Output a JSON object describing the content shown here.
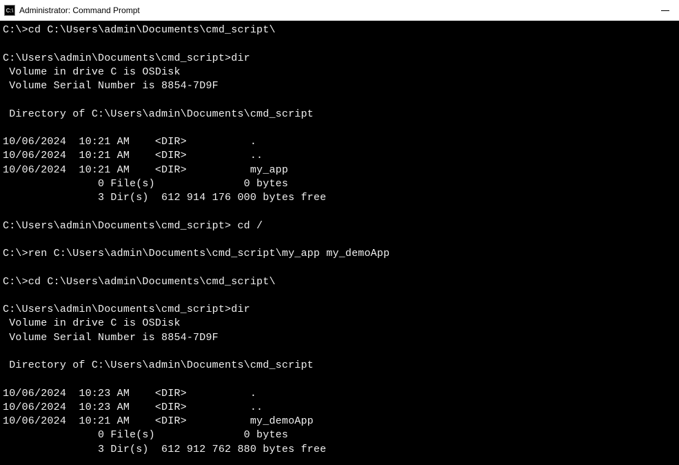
{
  "window": {
    "title": "Administrator: Command Prompt",
    "icon_label": "C:\\"
  },
  "lines": [
    "C:\\>cd C:\\Users\\admin\\Documents\\cmd_script\\",
    "",
    "C:\\Users\\admin\\Documents\\cmd_script>dir",
    " Volume in drive C is OSDisk",
    " Volume Serial Number is 8854-7D9F",
    "",
    " Directory of C:\\Users\\admin\\Documents\\cmd_script",
    "",
    "10/06/2024  10:21 AM    <DIR>          .",
    "10/06/2024  10:21 AM    <DIR>          ..",
    "10/06/2024  10:21 AM    <DIR>          my_app",
    "               0 File(s)              0 bytes",
    "               3 Dir(s)  612 914 176 000 bytes free",
    "",
    "C:\\Users\\admin\\Documents\\cmd_script> cd /",
    "",
    "C:\\>ren C:\\Users\\admin\\Documents\\cmd_script\\my_app my_demoApp",
    "",
    "C:\\>cd C:\\Users\\admin\\Documents\\cmd_script\\",
    "",
    "C:\\Users\\admin\\Documents\\cmd_script>dir",
    " Volume in drive C is OSDisk",
    " Volume Serial Number is 8854-7D9F",
    "",
    " Directory of C:\\Users\\admin\\Documents\\cmd_script",
    "",
    "10/06/2024  10:23 AM    <DIR>          .",
    "10/06/2024  10:23 AM    <DIR>          ..",
    "10/06/2024  10:21 AM    <DIR>          my_demoApp",
    "               0 File(s)              0 bytes",
    "               3 Dir(s)  612 912 762 880 bytes free"
  ]
}
